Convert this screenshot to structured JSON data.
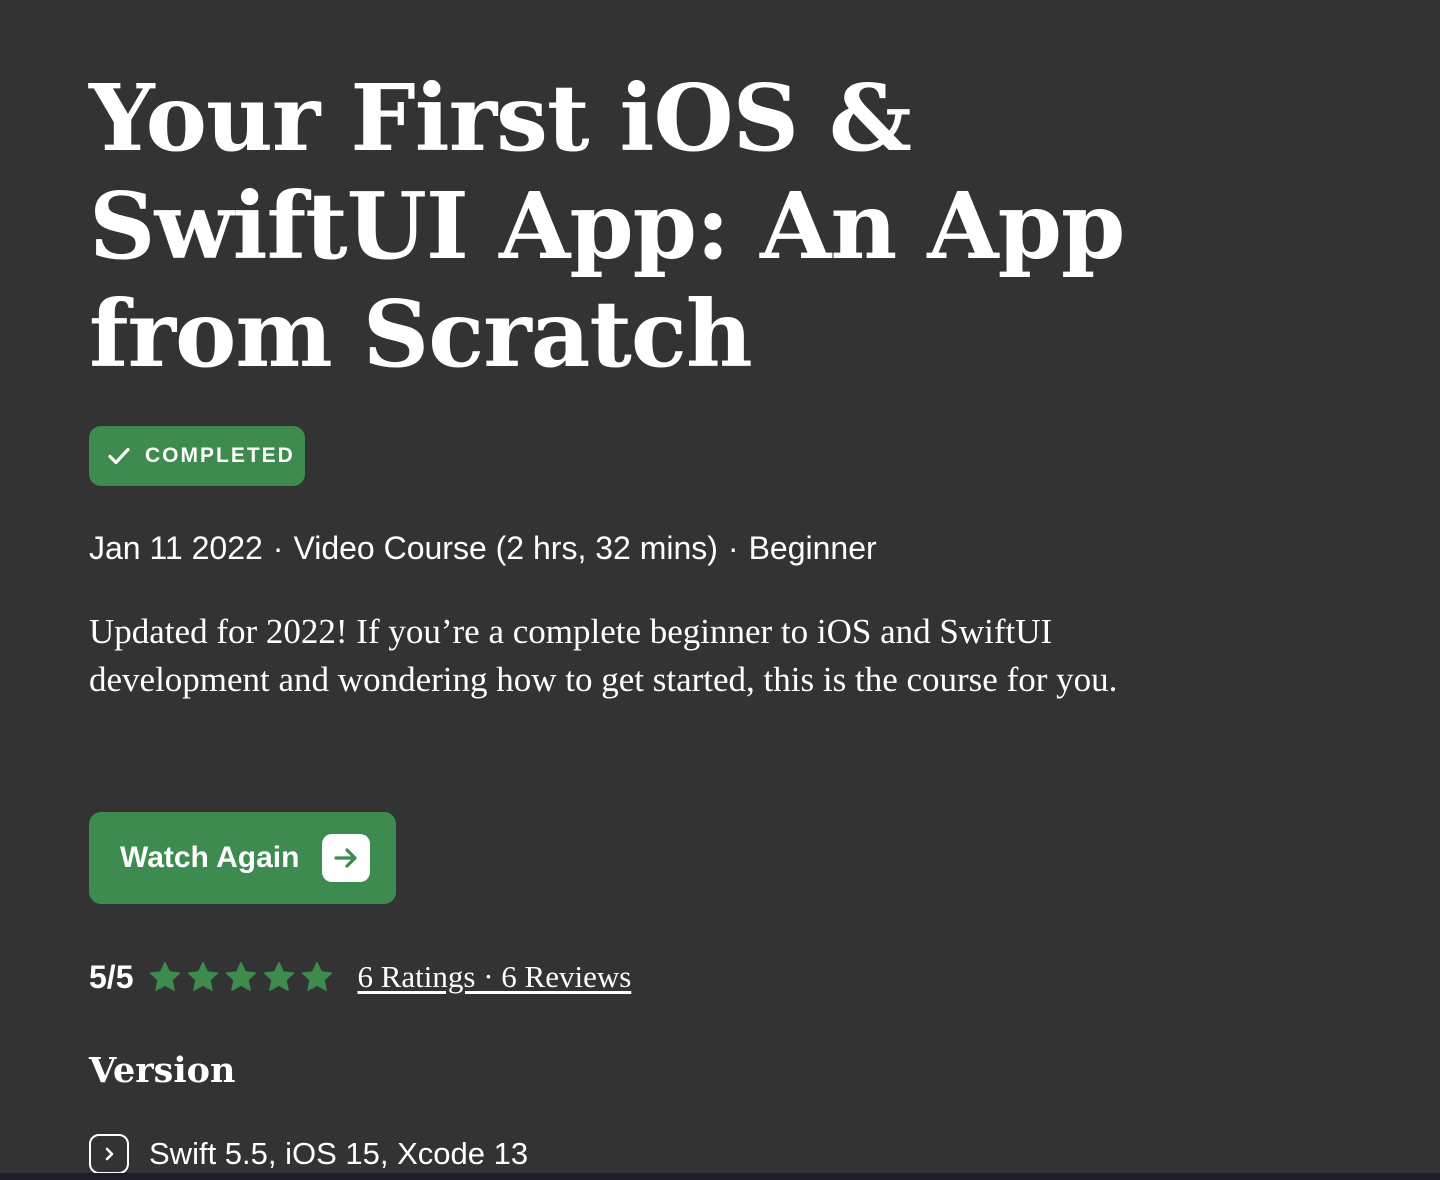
{
  "course": {
    "title": "Your First iOS & SwiftUI App: An App from Scratch",
    "status_badge": {
      "label": "COMPLETED",
      "icon": "checkmark-icon",
      "color": "#3d8b4f"
    },
    "meta": {
      "date": "Jan 11 2022",
      "type": "Video Course (2 hrs, 32 mins)",
      "level": "Beginner",
      "separator": "·"
    },
    "description": "Updated for 2022! If you’re a complete beginner to iOS and SwiftUI development and wondering how to get started, this is the course for you."
  },
  "action": {
    "label": "Watch Again",
    "icon": "arrow-right-icon",
    "color": "#3d8b4f"
  },
  "rating": {
    "score_text": "5/5",
    "stars_filled": 5,
    "stars_total": 5,
    "star_color": "#3d8b4f",
    "link_text": "6 Ratings · 6 Reviews"
  },
  "version": {
    "heading": "Version",
    "items": [
      {
        "label": "Swift 5.5, iOS 15, Xcode 13",
        "icon": "chevron-right-icon"
      }
    ]
  },
  "colors": {
    "background": "#333333",
    "text": "#ffffff",
    "accent": "#3d8b4f"
  }
}
